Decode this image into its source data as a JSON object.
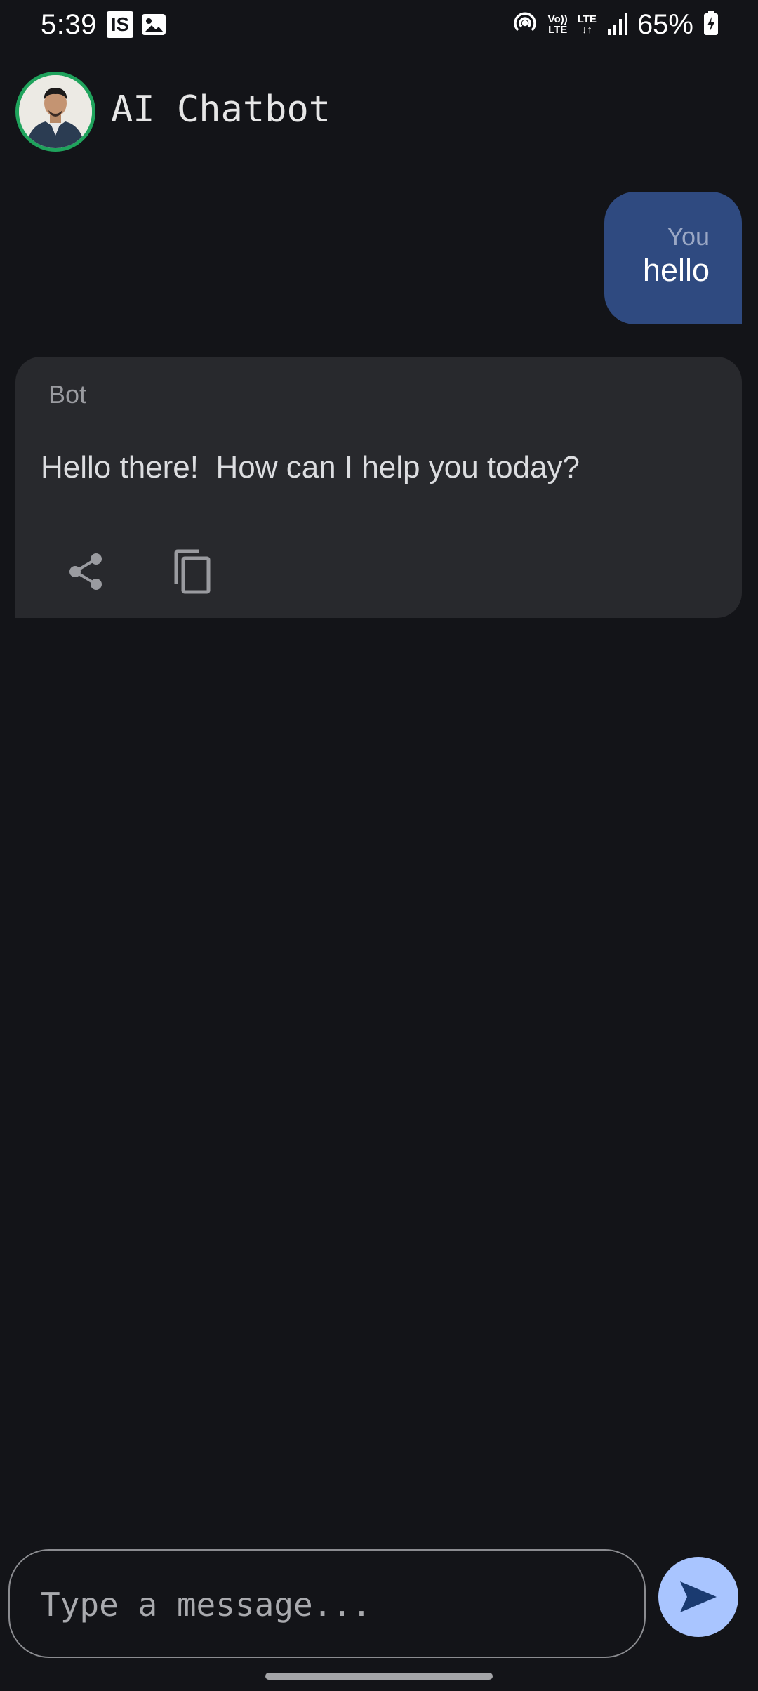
{
  "status_bar": {
    "time": "5:39",
    "badge_text": "IS",
    "volte_top": "Vo))",
    "volte_bottom": "LTE",
    "lte_top": "LTE",
    "lte_bottom": "↓↑",
    "battery": "65%",
    "icons": [
      "image-icon",
      "hotspot-icon",
      "signal-icon",
      "battery-charging-icon"
    ]
  },
  "header": {
    "title": "AI Chatbot",
    "avatar_icon": "avatar"
  },
  "messages": [
    {
      "sender": "You",
      "text": "hello"
    },
    {
      "sender": "Bot",
      "text": "Hello there!  How can I help you today?"
    }
  ],
  "bot_actions": {
    "icons": [
      "share-icon",
      "copy-icon"
    ]
  },
  "composer": {
    "placeholder": "Type a message...",
    "value": "",
    "send_icon": "send-icon"
  },
  "colors": {
    "background": "#131418",
    "user_bubble": "#2f4a80",
    "bot_card": "#28292d",
    "send_button": "#a9c5ff",
    "avatar_ring": "#1fa35c"
  }
}
